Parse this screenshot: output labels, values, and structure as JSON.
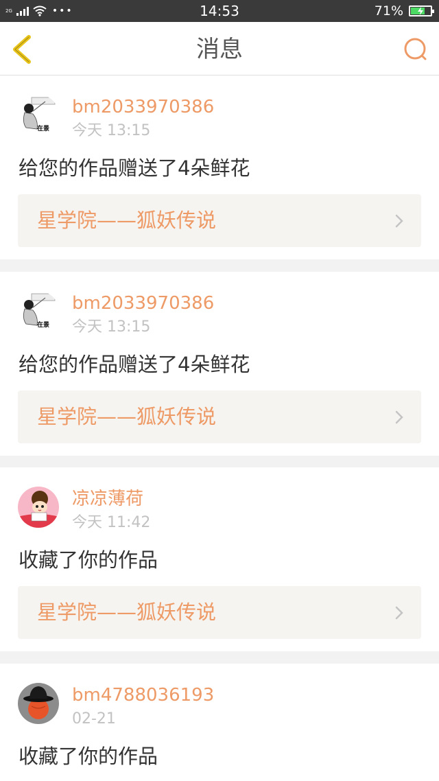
{
  "status_bar": {
    "network": "2G",
    "dots": "•••",
    "time": "14:53",
    "battery_percent": "71%",
    "battery_level": 0.71,
    "battery_charging": true
  },
  "nav": {
    "title": "消息",
    "back_icon": "chevron-left-icon",
    "search_icon": "search-icon"
  },
  "colors": {
    "accent": "#ee9a66",
    "nav_back": "#e8c41a",
    "status_bar_bg": "#3a3a3a",
    "card_link_bg": "#f5f4f0"
  },
  "messages": [
    {
      "username": "bm2033970386",
      "time": "今天 13:15",
      "text": "给您的作品赠送了4朵鲜花",
      "work_title": "星学院——狐妖传说",
      "avatar_icon": "user-avatar-drawing",
      "avatar_text": "在景"
    },
    {
      "username": "bm2033970386",
      "time": "今天 13:15",
      "text": "给您的作品赠送了4朵鲜花",
      "work_title": "星学院——狐妖传说",
      "avatar_icon": "user-avatar-drawing",
      "avatar_text": "在景"
    },
    {
      "username": "凉凉薄荷",
      "time": "今天 11:42",
      "text": "收藏了你的作品",
      "work_title": "星学院——狐妖传说",
      "avatar_icon": "user-avatar-cartoon-girl"
    },
    {
      "username": "bm4788036193",
      "time": "02-21",
      "text": "收藏了你的作品",
      "avatar_icon": "user-avatar-hat-orange"
    }
  ]
}
